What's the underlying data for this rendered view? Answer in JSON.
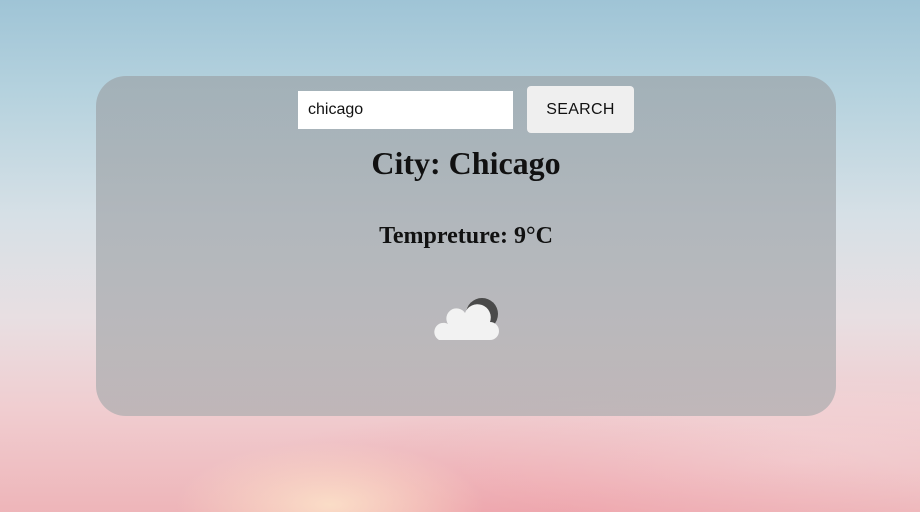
{
  "search": {
    "value": "chicago",
    "button_label": "SEARCH"
  },
  "weather": {
    "city_label": "City: Chicago",
    "temperature_label": "Tempreture: 9°C",
    "icon": "partly-cloudy-night-icon"
  }
}
